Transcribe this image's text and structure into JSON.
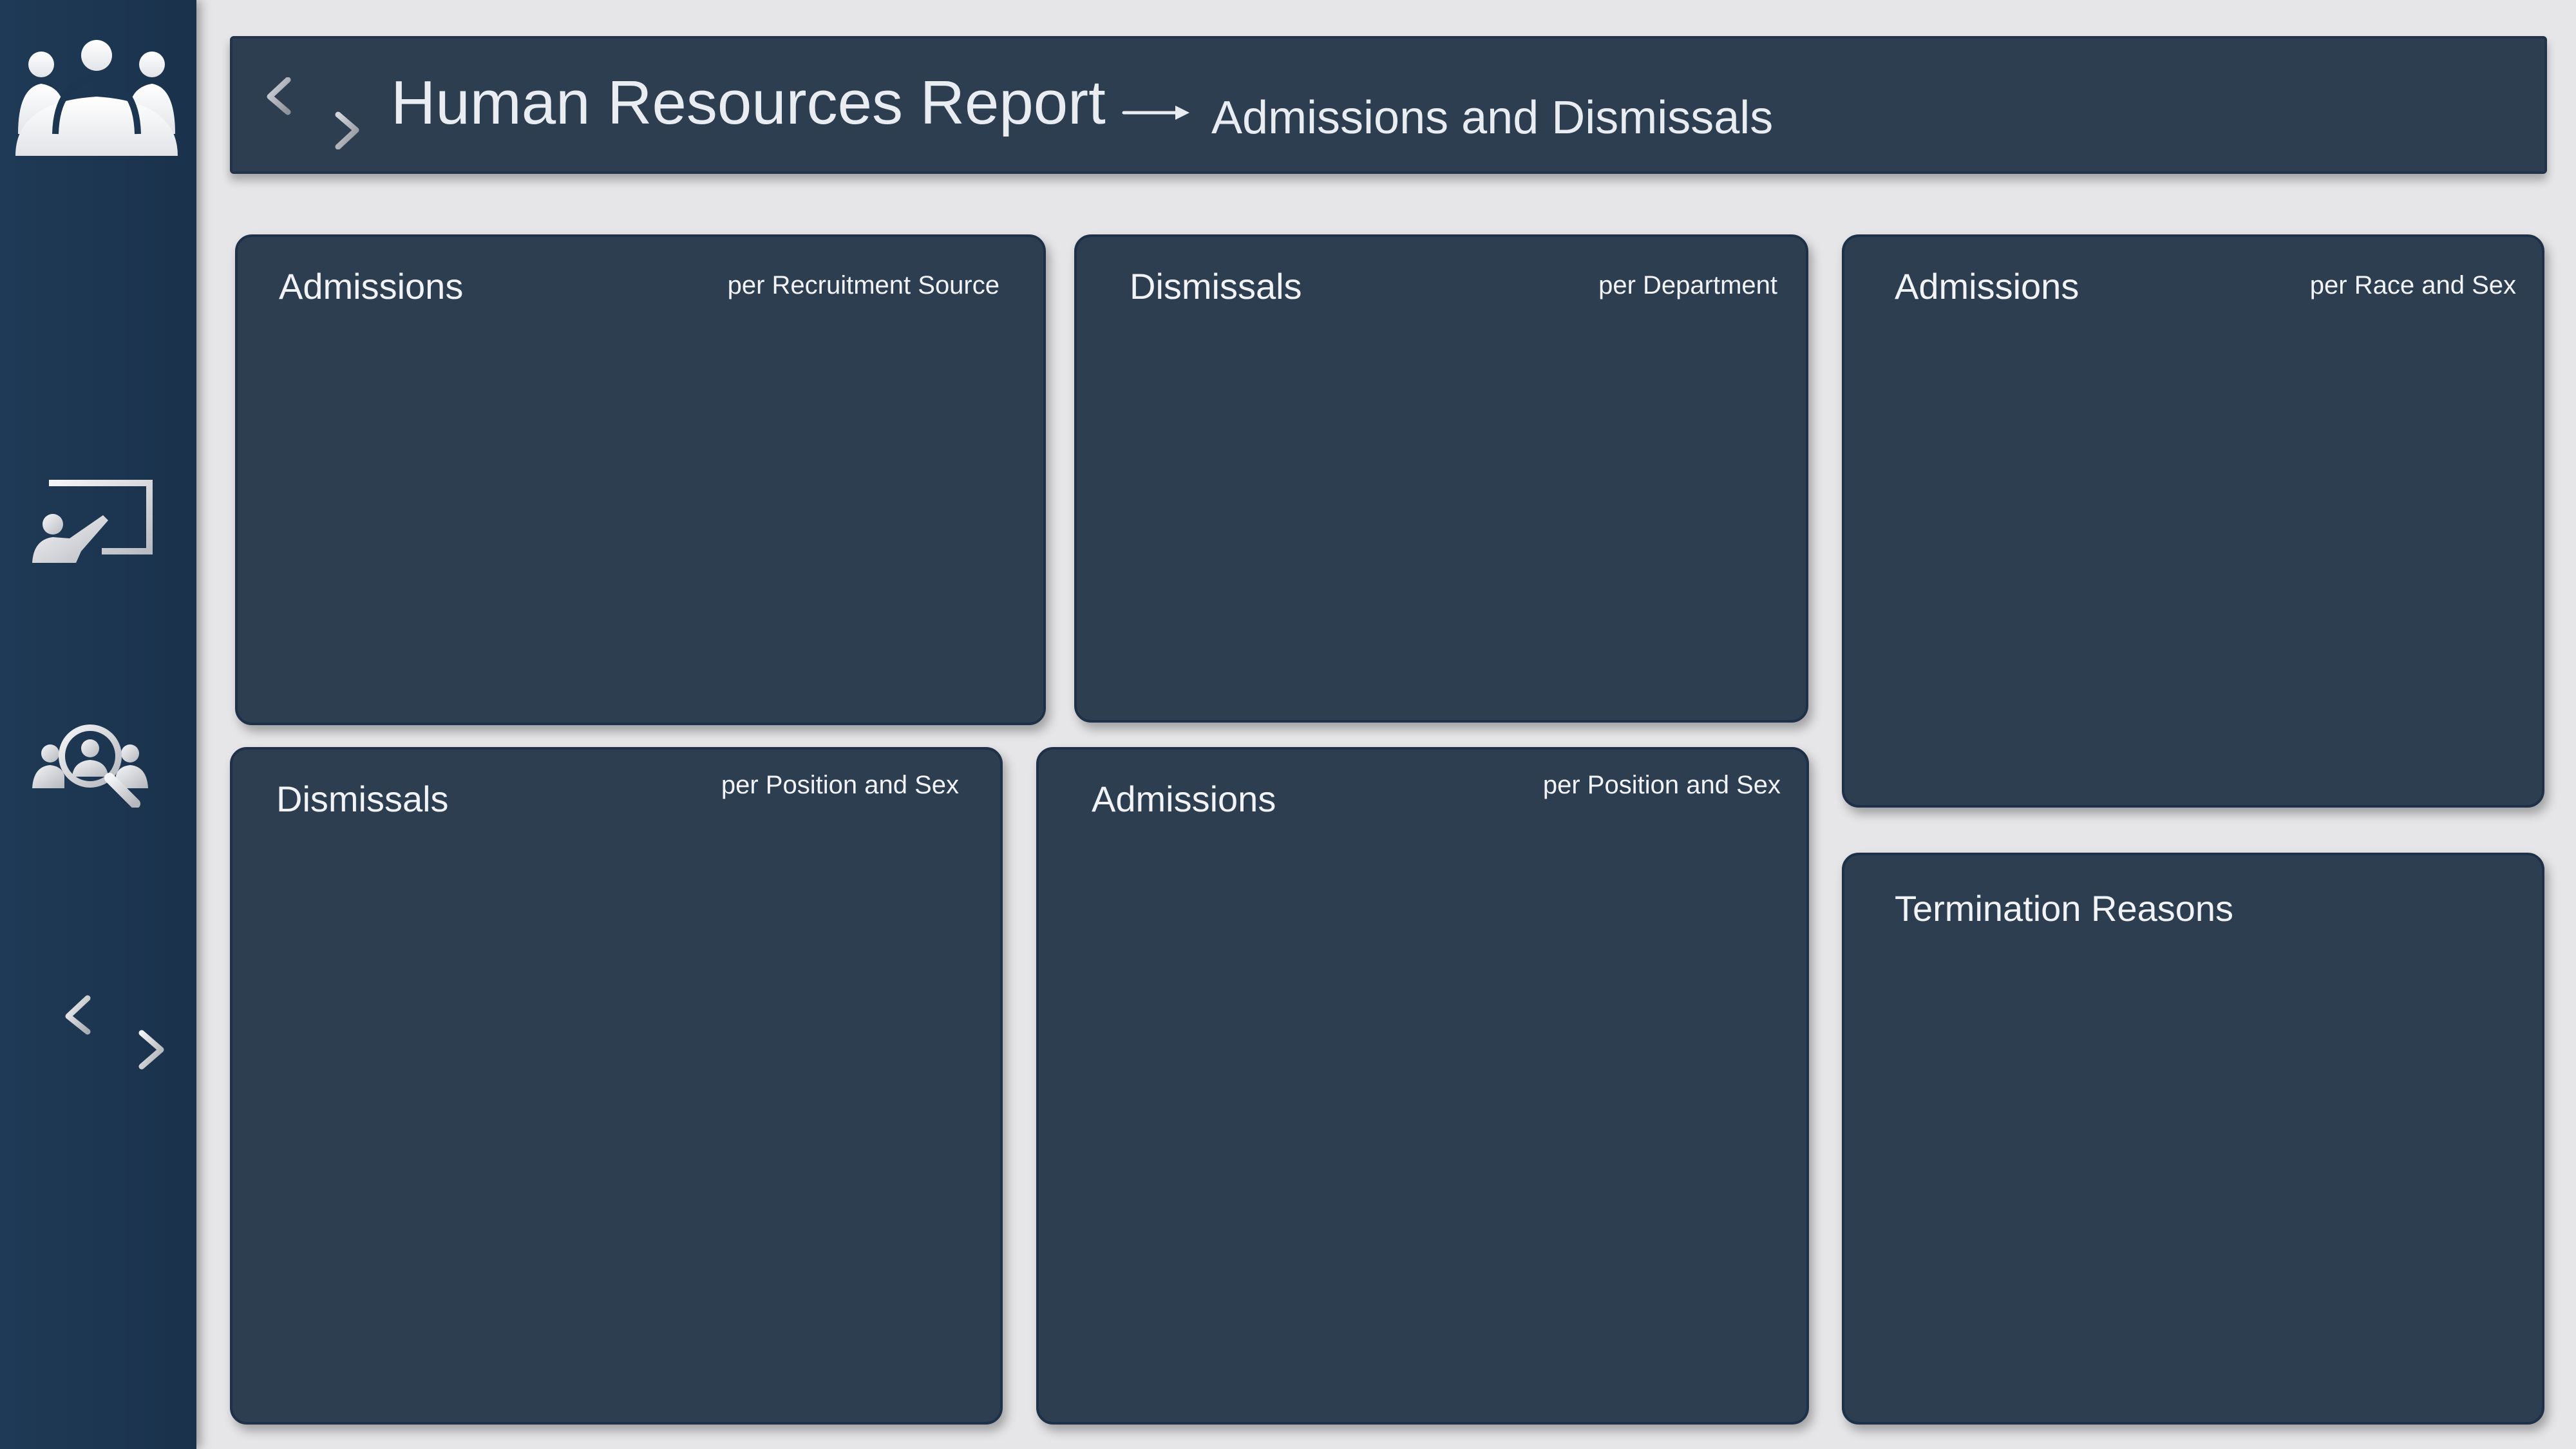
{
  "header": {
    "title": "Human Resources Report",
    "subtitle": "Admissions and Dismissals"
  },
  "sidebar": {
    "items": [
      {
        "icon": "people-group-icon"
      },
      {
        "icon": "presentation-icon"
      },
      {
        "icon": "people-search-icon"
      },
      {
        "icon": "swap-arrows-icon"
      }
    ]
  },
  "cards": {
    "admissions_recruitment": {
      "title": "Admissions",
      "subtitle": "per Recruitment Source"
    },
    "dismissals_department": {
      "title": "Dismissals",
      "subtitle": "per Department"
    },
    "admissions_race_sex": {
      "title": "Admissions",
      "subtitle": "per Race and Sex"
    },
    "dismissals_position_sex": {
      "title": "Dismissals",
      "subtitle": "per Position and Sex"
    },
    "admissions_position_sex": {
      "title": "Admissions",
      "subtitle": "per Position and Sex"
    },
    "termination_reasons": {
      "title": "Termination Reasons"
    }
  },
  "colors": {
    "background": "#e6e6e8",
    "sidebar": "#1c3550",
    "panel": "#2d3e50",
    "text": "#f1f3f6",
    "icon": "#d8dadd"
  }
}
